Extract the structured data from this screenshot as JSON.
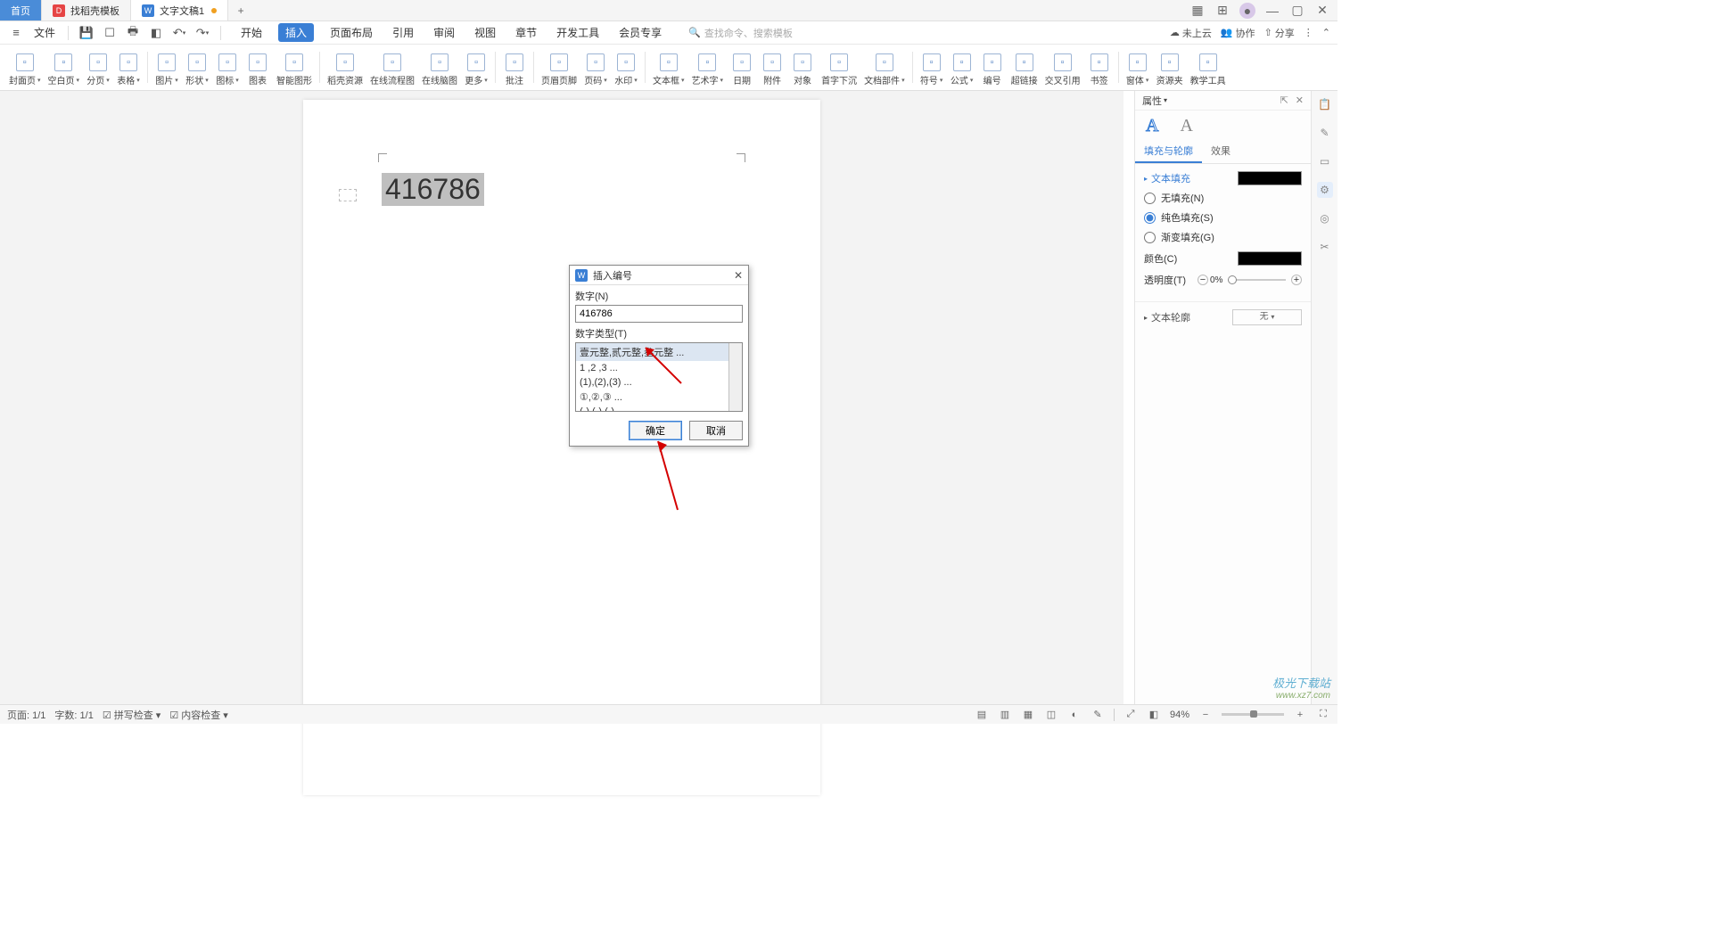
{
  "titlebar": {
    "tabs": [
      {
        "label": "首页",
        "kind": "home"
      },
      {
        "label": "找稻壳模板",
        "kind": "daoke"
      },
      {
        "label": "文字文稿1",
        "kind": "doc",
        "dirty": true
      }
    ],
    "window_controls": [
      "layout-icon",
      "apps-icon",
      "avatar-icon",
      "min-icon",
      "max-icon",
      "close-icon"
    ]
  },
  "menubar": {
    "file_label": "文件",
    "quick_icons": [
      "menu",
      "save",
      "saveas",
      "print",
      "preview",
      "undo",
      "redo"
    ],
    "tabs": [
      "开始",
      "插入",
      "页面布局",
      "引用",
      "审阅",
      "视图",
      "章节",
      "开发工具",
      "会员专享"
    ],
    "active_tab_index": 1,
    "search_icon": "search",
    "search_placeholder": "查找命令、搜索模板",
    "right": [
      {
        "icon": "cloud",
        "label": "未上云"
      },
      {
        "icon": "collab",
        "label": "协作"
      },
      {
        "icon": "share",
        "label": "分享"
      },
      {
        "icon": "more",
        "label": ""
      },
      {
        "icon": "launch",
        "label": ""
      }
    ]
  },
  "ribbon": {
    "items": [
      {
        "id": "cover",
        "lbl": "封面页",
        "dd": true
      },
      {
        "id": "blank",
        "lbl": "空白页",
        "dd": true
      },
      {
        "id": "pagebreak",
        "lbl": "分页",
        "dd": true
      },
      {
        "id": "table",
        "lbl": "表格",
        "dd": true,
        "sep": true
      },
      {
        "id": "picture",
        "lbl": "图片",
        "dd": true
      },
      {
        "id": "shape",
        "lbl": "形状",
        "dd": true
      },
      {
        "id": "icon",
        "lbl": "图标",
        "dd": true
      },
      {
        "id": "chart",
        "lbl": "图表"
      },
      {
        "id": "smart",
        "lbl": "智能图形",
        "sep": true
      },
      {
        "id": "daoke-res",
        "lbl": "稻壳资源"
      },
      {
        "id": "flow",
        "lbl": "在线流程图"
      },
      {
        "id": "mind",
        "lbl": "在线脑图"
      },
      {
        "id": "more",
        "lbl": "更多",
        "dd": true,
        "sep": true
      },
      {
        "id": "comment",
        "lbl": "批注",
        "sep": true
      },
      {
        "id": "headerfooter",
        "lbl": "页眉页脚"
      },
      {
        "id": "pagenum",
        "lbl": "页码",
        "dd": true
      },
      {
        "id": "watermark",
        "lbl": "水印",
        "dd": true,
        "sep": true
      },
      {
        "id": "textbox",
        "lbl": "文本框",
        "dd": true
      },
      {
        "id": "wordart",
        "lbl": "艺术字",
        "dd": true
      },
      {
        "id": "date",
        "lbl": "日期"
      },
      {
        "id": "attach",
        "lbl": "附件"
      },
      {
        "id": "object-s",
        "lbl": "对象"
      },
      {
        "id": "dropcap-s",
        "lbl": "首字下沉"
      },
      {
        "id": "docpart",
        "lbl": "文档部件",
        "dd": true,
        "sep": true
      },
      {
        "id": "symbol",
        "lbl": "符号",
        "dd": true
      },
      {
        "id": "equation",
        "lbl": "公式",
        "dd": true
      },
      {
        "id": "number",
        "lbl": "编号"
      },
      {
        "id": "hyperlink",
        "lbl": "超链接"
      },
      {
        "id": "xref-s",
        "lbl": "交叉引用"
      },
      {
        "id": "bookmark",
        "lbl": "书签",
        "sep": true
      },
      {
        "id": "window",
        "lbl": "窗体",
        "dd": true
      },
      {
        "id": "res",
        "lbl": "资源夹"
      },
      {
        "id": "jxtool",
        "lbl": "教学工具"
      }
    ]
  },
  "document": {
    "big_number": "416786"
  },
  "dialog": {
    "title": "插入编号",
    "num_label": "数字(N)",
    "num_value": "416786",
    "type_label": "数字类型(T)",
    "options": [
      "壹元整,贰元整,叁元整 ...",
      "1 ,2 ,3 ...",
      "(1),(2),(3) ...",
      "①,②,③ ...",
      "(-),(-),(-) ..."
    ],
    "selected_index": 0,
    "ok": "确定",
    "cancel": "取消"
  },
  "sidebar": {
    "header": "属性",
    "appearance_letter": "A",
    "tab_fill": "填充与轮廓",
    "tab_effect": "效果",
    "sec_textfill": "文本填充",
    "fill_none": "无填充(N)",
    "fill_solid": "纯色填充(S)",
    "fill_gradient": "渐变填充(G)",
    "fill_selected": "solid",
    "color_label": "颜色(C)",
    "opacity_label": "透明度(T)",
    "opacity_value": "0%",
    "sec_textoutline": "文本轮廓",
    "outline_select": "无"
  },
  "status": {
    "page": "页面: 1/1",
    "words": "字数: 1/1",
    "spell": "拼写检查",
    "content": "内容检查",
    "zoom": "94%"
  },
  "watermark": {
    "line1": "极光下载站",
    "line2": "www.xz7.com"
  }
}
